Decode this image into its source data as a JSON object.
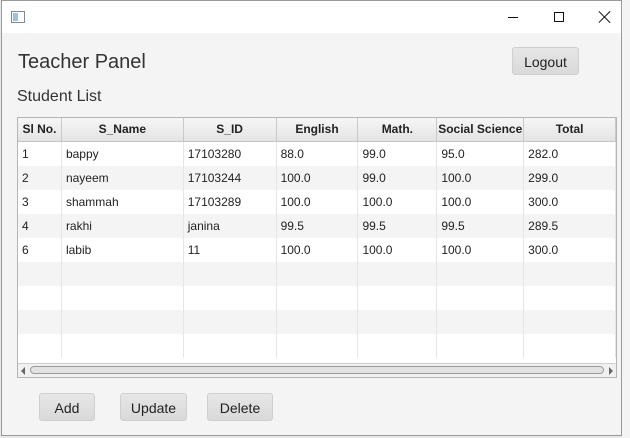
{
  "window": {
    "icon": "app-window-icon"
  },
  "titlebar_controls": {
    "minimize": "minimize-icon",
    "maximize": "maximize-icon",
    "close": "close-icon"
  },
  "panel": {
    "title": "Teacher Panel",
    "subtitle": "Student List",
    "logout_label": "Logout"
  },
  "table": {
    "columns": [
      "Sl No.",
      "S_Name",
      "S_ID",
      "English",
      "Math.",
      "Social Science",
      "Total"
    ],
    "rows": [
      [
        "1",
        "bappy",
        "17103280",
        "88.0",
        "99.0",
        "95.0",
        "282.0"
      ],
      [
        "2",
        "nayeem",
        "17103244",
        "100.0",
        "99.0",
        "100.0",
        "299.0"
      ],
      [
        "3",
        "shammah",
        "17103289",
        "100.0",
        "100.0",
        "100.0",
        "300.0"
      ],
      [
        "4",
        "rakhi",
        "janina",
        "99.5",
        "99.5",
        "99.5",
        "289.5"
      ],
      [
        "6",
        "labib",
        "11",
        "100.0",
        "100.0",
        "100.0",
        "300.0"
      ],
      [
        "",
        "",
        "",
        "",
        "",
        "",
        ""
      ],
      [
        "",
        "",
        "",
        "",
        "",
        "",
        ""
      ],
      [
        "",
        "",
        "",
        "",
        "",
        "",
        ""
      ],
      [
        "",
        "",
        "",
        "",
        "",
        "",
        ""
      ]
    ]
  },
  "actions": {
    "add_label": "Add",
    "update_label": "Update",
    "delete_label": "Delete"
  }
}
